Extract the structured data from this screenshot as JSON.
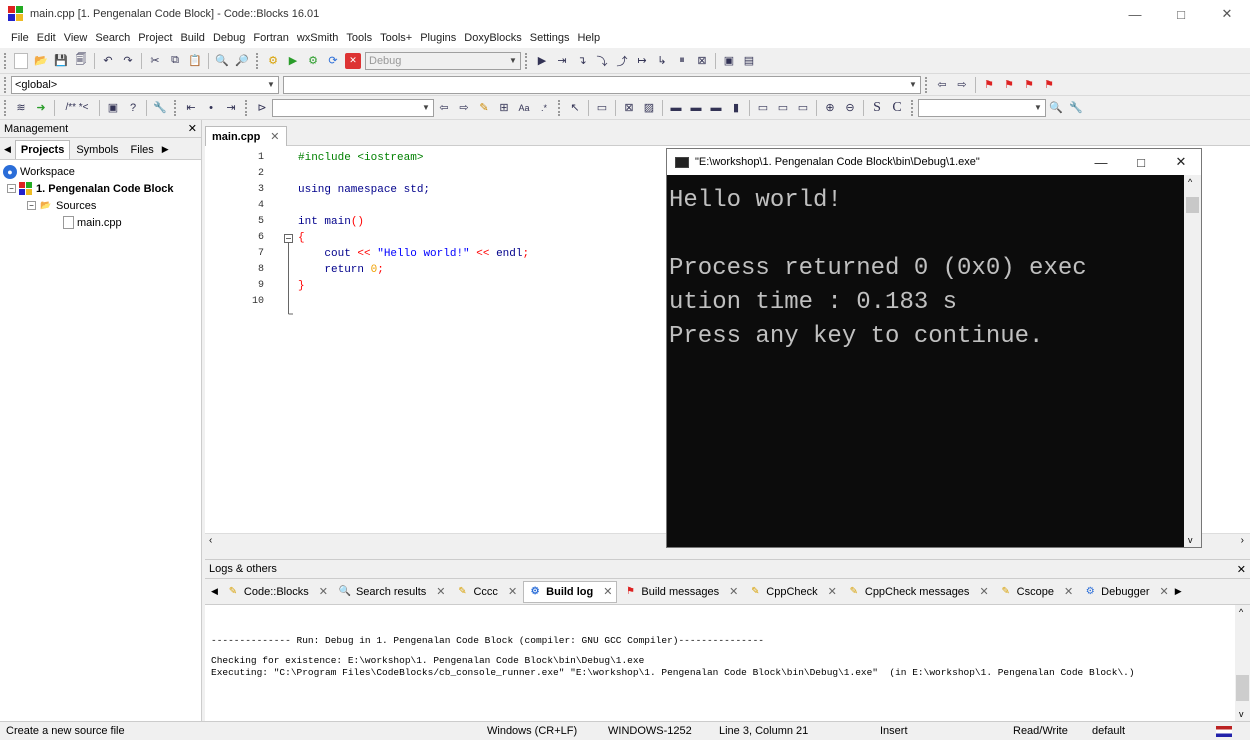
{
  "window": {
    "title": "main.cpp [1. Pengenalan Code Block] - Code::Blocks 16.01",
    "minimize": "—",
    "maximize": "□",
    "close": "✕"
  },
  "menu": [
    "File",
    "Edit",
    "View",
    "Search",
    "Project",
    "Build",
    "Debug",
    "Fortran",
    "wxSmith",
    "Tools",
    "Tools+",
    "Plugins",
    "DoxyBlocks",
    "Settings",
    "Help"
  ],
  "toolbar": {
    "build_target": "Debug",
    "scope": "<global>",
    "icons": [
      "new-file-icon",
      "open-icon",
      "save-icon",
      "save-all-icon",
      "undo-icon",
      "redo-icon",
      "cut-icon",
      "copy-icon",
      "paste-icon",
      "find-icon",
      "replace-icon",
      "build-icon",
      "run-icon",
      "build-run-icon",
      "rebuild-icon",
      "abort-icon"
    ]
  },
  "management": {
    "title": "Management",
    "close": "✕",
    "tabs": [
      "Projects",
      "Symbols",
      "Files"
    ],
    "tree": {
      "workspace": "Workspace",
      "project": "1. Pengenalan Code Block",
      "folder": "Sources",
      "file": "main.cpp"
    }
  },
  "editor": {
    "tab_label": "main.cpp",
    "tab_close": "✕",
    "line_numbers": [
      "1",
      "2",
      "3",
      "4",
      "5",
      "6",
      "7",
      "8",
      "9",
      "10"
    ]
  },
  "console": {
    "title": "\"E:\\workshop\\1. Pengenalan Code Block\\bin\\Debug\\1.exe\"",
    "lines": [
      "Hello world!",
      "",
      "Process returned 0 (0x0)   exec",
      "ution time : 0.183 s",
      "Press any key to continue."
    ]
  },
  "logs": {
    "title": "Logs & others",
    "close": "✕",
    "tabs": [
      {
        "label": "Code::Blocks",
        "icon": "pencil-icon"
      },
      {
        "label": "Search results",
        "icon": "magnifier-icon"
      },
      {
        "label": "Cccc",
        "icon": "pencil-icon"
      },
      {
        "label": "Build log",
        "icon": "gear-icon"
      },
      {
        "label": "Build messages",
        "icon": "flag-icon"
      },
      {
        "label": "CppCheck",
        "icon": "pencil-icon"
      },
      {
        "label": "CppCheck messages",
        "icon": "pencil-icon"
      },
      {
        "label": "Cscope",
        "icon": "pencil-icon"
      },
      {
        "label": "Debugger",
        "icon": "gear-icon"
      }
    ],
    "lines": [
      "-------------- Run: Debug in 1. Pengenalan Code Block (compiler: GNU GCC Compiler)---------------",
      "",
      "Checking for existence: E:\\workshop\\1. Pengenalan Code Block\\bin\\Debug\\1.exe",
      "Executing: \"C:\\Program Files\\CodeBlocks/cb_console_runner.exe\" \"E:\\workshop\\1. Pengenalan Code Block\\bin\\Debug\\1.exe\"  (in E:\\workshop\\1. Pengenalan Code Block\\.)"
    ]
  },
  "status": {
    "message": "Create a new source file",
    "eol": "Windows (CR+LF)",
    "encoding": "WINDOWS-1252",
    "position": "Line 3, Column 21",
    "mode": "Insert",
    "access": "Read/Write",
    "profile": "default"
  }
}
